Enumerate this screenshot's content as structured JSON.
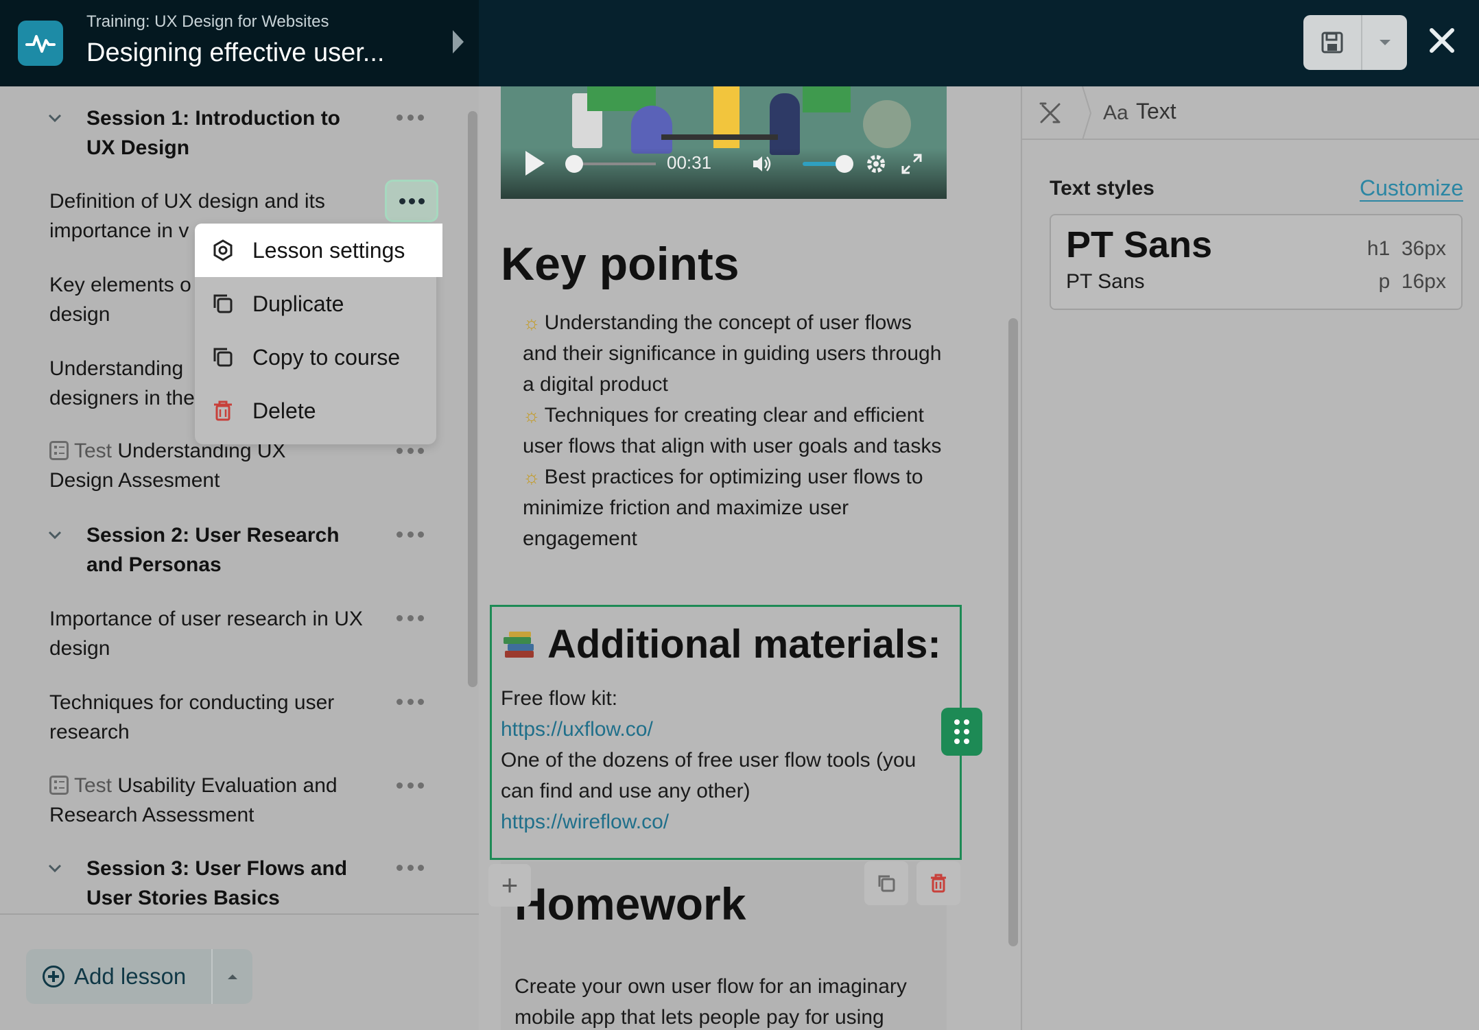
{
  "header": {
    "course_subtitle": "Training: UX Design for Websites",
    "lesson_title": "Designing effective user...",
    "save_icon": "floppy-disk-icon",
    "close_icon": "close-icon"
  },
  "sidebar": {
    "sessions": [
      {
        "title": "Session 1: Introduction to UX Design"
      },
      {
        "title": "Session 2: User Research and Personas"
      },
      {
        "title": "Session 3: User Flows and User Stories Basics"
      }
    ],
    "lessons": [
      {
        "label": "Definition of UX design and its importance in v"
      },
      {
        "label": "Key elements o design"
      },
      {
        "label": "Understanding designers in the"
      },
      {
        "prefix": "Test",
        "label": "Understanding UX Design Assesment"
      },
      {
        "label": "Importance of user research in UX design"
      },
      {
        "label": "Techniques for conducting user research"
      },
      {
        "prefix": "Test",
        "label": "Usability Evaluation and Research Assessment"
      }
    ],
    "add_lesson_label": "Add lesson"
  },
  "context_menu": {
    "items": [
      {
        "label": "Lesson settings",
        "icon": "settings-hexagon-icon"
      },
      {
        "label": "Duplicate",
        "icon": "duplicate-icon"
      },
      {
        "label": "Copy to course",
        "icon": "copy-icon"
      },
      {
        "label": "Delete",
        "icon": "trash-icon"
      }
    ]
  },
  "editor": {
    "video_time": "00:31",
    "key_points_heading": "Key points",
    "key_points": [
      "Understanding the concept of user flows and their significance in guiding users through a digital product",
      "Techniques for creating clear and efficient user flows that align with user goals and tasks",
      "Best practices for optimizing user flows to minimize friction and maximize user engagement"
    ],
    "additional_heading": "Additional materials:",
    "additional_lines": [
      {
        "text": "Free flow kit:",
        "link": false
      },
      {
        "text": "https://uxflow.co/",
        "link": true
      },
      {
        "text": "One of the dozens of free user flow tools (you can find and use any other)",
        "link": false
      },
      {
        "text": "https://wireflow.co/",
        "link": true
      }
    ],
    "homework_heading": "Homework",
    "homework_body": "Create your own user flow for an imaginary mobile app that lets people pay for using"
  },
  "right_panel": {
    "breadcrumb_aa": "Aa",
    "breadcrumb_text": "Text",
    "text_styles_label": "Text styles",
    "customize_label": "Customize",
    "h1_font": "PT Sans",
    "p_font": "PT Sans",
    "h1_spec": "h1  36px",
    "p_spec": "p  16px"
  },
  "colors": {
    "accent_green": "#1d8a55",
    "link_blue": "#1f6f8a",
    "header_bg": "#06212d",
    "delete_red": "#c8403a"
  }
}
